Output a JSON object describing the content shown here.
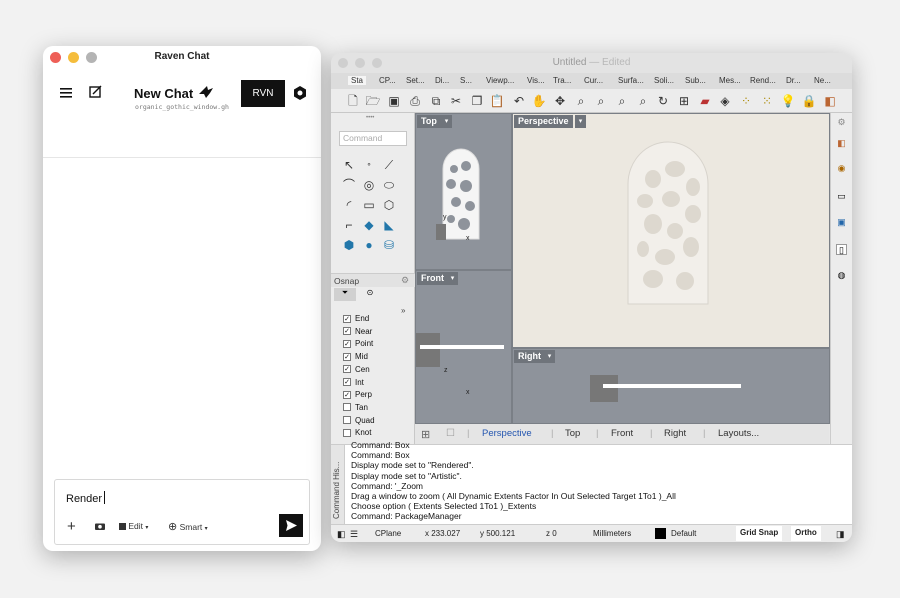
{
  "raven": {
    "window_title": "Raven Chat",
    "chat_title": "New Chat",
    "file_name": "organic_gothic_window.gh",
    "rvn_button": "RVN",
    "input_value": "Render",
    "edit_label": "Edit",
    "smart_label": "Smart"
  },
  "rhino": {
    "window_title": "Untitled",
    "window_status": "— Edited",
    "tabs": [
      "Sta",
      "CP...",
      "Set...",
      "Di...",
      "S...",
      "Viewp...",
      "Vis...",
      "Tra...",
      "Cur...",
      "Surfa...",
      "Soli...",
      "Sub...",
      "Mes...",
      "Rend...",
      "Dr...",
      "Ne..."
    ],
    "command_placeholder": "Command",
    "osnap_title": "Osnap",
    "osnap_items": [
      {
        "label": "End",
        "checked": true
      },
      {
        "label": "Near",
        "checked": true
      },
      {
        "label": "Point",
        "checked": true
      },
      {
        "label": "Mid",
        "checked": true
      },
      {
        "label": "Cen",
        "checked": true
      },
      {
        "label": "Int",
        "checked": true
      },
      {
        "label": "Perp",
        "checked": true
      },
      {
        "label": "Tan",
        "checked": false
      },
      {
        "label": "Quad",
        "checked": false
      },
      {
        "label": "Knot",
        "checked": false
      }
    ],
    "viewports": {
      "top": "Top",
      "perspective": "Perspective",
      "front": "Front",
      "right": "Right"
    },
    "viewport_tabs": [
      "Perspective",
      "Top",
      "Front",
      "Right",
      "Layouts..."
    ],
    "command_history_label": "Command His...",
    "command_history": [
      "Command: Box",
      "Command: Box",
      "Display mode set to \"Rendered\".",
      "Display mode set to \"Artistic\".",
      "Command: '_Zoom",
      "Drag a window to zoom ( All Dynamic Extents Factor In Out Selected Target 1To1 )_All",
      "Choose option ( Extents Selected 1To1 )_Extents",
      "Command: PackageManager"
    ],
    "status": {
      "cplane": "CPlane",
      "x": "x 233.027",
      "y": "y 500.121",
      "z": "z 0",
      "units": "Millimeters",
      "layer": "Default",
      "grid_snap": "Grid Snap",
      "ortho": "Ortho"
    },
    "axis": {
      "x": "x",
      "y": "y",
      "z": "z"
    }
  },
  "colors": {
    "viewport_bg": "#8e939b",
    "perspective_bg": "#ece8e0",
    "accent_link": "#2456b0",
    "rvn_bg": "#111111"
  }
}
